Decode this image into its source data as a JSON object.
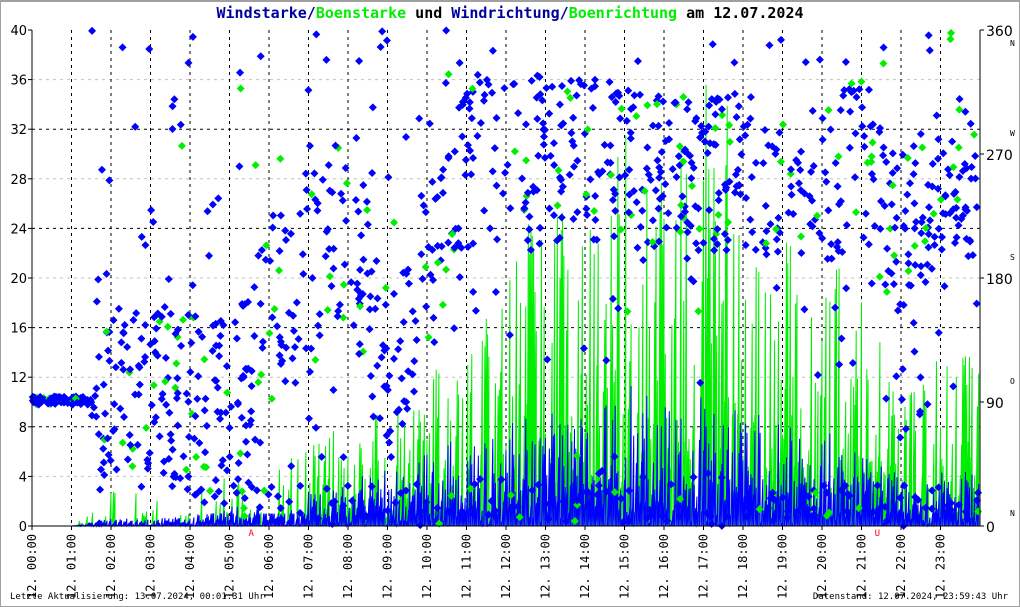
{
  "title": {
    "part1": "Windstarke",
    "sep1": "/",
    "part2": "Boenstarke",
    "mid": " und ",
    "part3": "Windrichtung",
    "sep2": "/",
    "part4": "Boenrichtung",
    "tail": " am 12.07.2024"
  },
  "footer": {
    "left": "Letzte Aktualisierung: 13.07.2024, 00:01:31 Uhr",
    "right": "Datenstand: 12.07.2024, 23:59:43 Uhr"
  },
  "colors": {
    "wind": "#0000ff",
    "gust": "#00ee00",
    "title_blue": "#0000a0",
    "marker": "#ff0000"
  },
  "chart_data": {
    "type": "line",
    "title": "Windstarke/Boenstarke und Windrichtung/Boenrichtung am 12.07.2024",
    "xlabel": "",
    "ylabel": "",
    "ylim": [
      0,
      40
    ],
    "y_ticks": [
      "0",
      "4",
      "8",
      "12",
      "16",
      "20",
      "24",
      "28",
      "32",
      "36",
      "40"
    ],
    "y2lim": [
      0,
      360
    ],
    "y2_ticks": [
      {
        "value": "0",
        "dir": "N"
      },
      {
        "value": "90",
        "dir": "O"
      },
      {
        "value": "180",
        "dir": "S"
      },
      {
        "value": "270",
        "dir": "W"
      },
      {
        "value": "360",
        "dir": "N"
      }
    ],
    "x_ticks": [
      "12. 00:00",
      "12. 01:00",
      "12. 02:00",
      "12. 03:00",
      "12. 04:00",
      "12. 05:00",
      "12. 06:00",
      "12. 07:00",
      "12. 08:00",
      "12. 09:00",
      "12. 10:00",
      "12. 11:00",
      "12. 12:00",
      "12. 13:00",
      "12. 14:00",
      "12. 15:00",
      "12. 16:00",
      "12. 17:00",
      "12. 18:00",
      "12. 19:00",
      "12. 20:00",
      "12. 21:00",
      "12. 22:00",
      "12. 23:00"
    ],
    "markers": [
      {
        "label": "A",
        "hour": 5.55
      },
      {
        "label": "U",
        "hour": 21.4
      }
    ],
    "grid": true,
    "hours": [
      0,
      1,
      2,
      3,
      4,
      5,
      6,
      7,
      8,
      9,
      10,
      11,
      12,
      13,
      14,
      15,
      16,
      17,
      18,
      19,
      20,
      21,
      22,
      23
    ],
    "series": [
      {
        "name": "Windstarke",
        "values": [
          0,
          0,
          0.3,
          0.3,
          0.4,
          0.8,
          1,
          1.5,
          2,
          2.5,
          3,
          4,
          4,
          5,
          5,
          6,
          5,
          5.5,
          5,
          4,
          4,
          3,
          2,
          2.2
        ]
      },
      {
        "name": "Boenstarke",
        "values": [
          0,
          0,
          3,
          2.5,
          3,
          4,
          5,
          8,
          7.5,
          10,
          12,
          16,
          20,
          28,
          24,
          34,
          28,
          36,
          35,
          26,
          22,
          20,
          10,
          14
        ]
      },
      {
        "name": "Windrichtung",
        "values": [
          88,
          90,
          95,
          95,
          85,
          80,
          160,
          180,
          220,
          100,
          200,
          260,
          270,
          260,
          270,
          260,
          260,
          250,
          260,
          250,
          240,
          270,
          200,
          250
        ]
      },
      {
        "name": "Boenrichtung",
        "values": [
          88,
          90,
          95,
          95,
          85,
          80,
          160,
          180,
          220,
          100,
          200,
          260,
          270,
          260,
          270,
          260,
          260,
          250,
          260,
          250,
          240,
          270,
          200,
          250
        ]
      }
    ]
  }
}
